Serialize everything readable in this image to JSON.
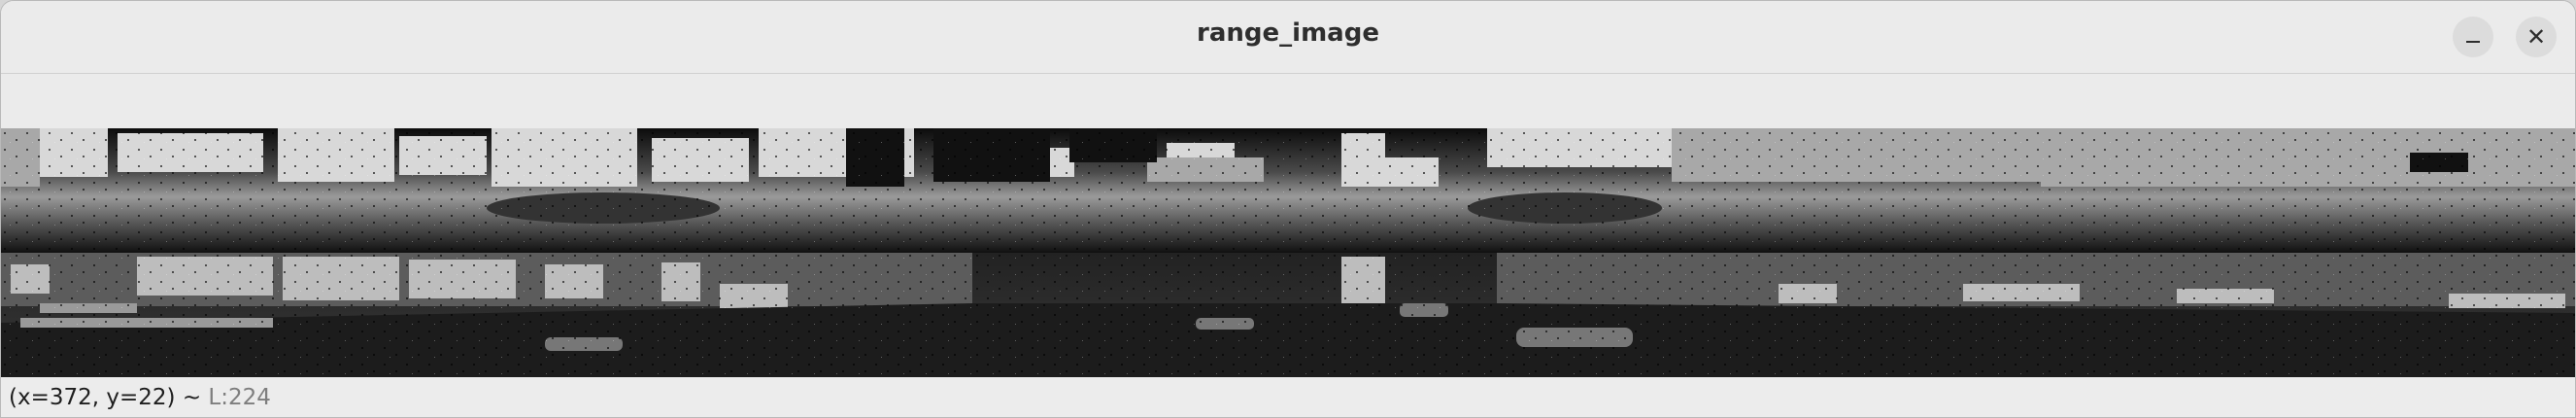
{
  "window": {
    "title": "range_image"
  },
  "controls": {
    "minimize_icon": "minimize-icon",
    "close_icon": "close-icon"
  },
  "image": {
    "description_kind": "grayscale lidar range image panorama",
    "colors": {
      "far": "#e6e6e6",
      "mid": "#8a8a8a",
      "near": "#1a1a1a",
      "background": "#000000"
    }
  },
  "status": {
    "coords": "(x=372, y=22)",
    "separator": " ~ ",
    "value": "L:224"
  }
}
